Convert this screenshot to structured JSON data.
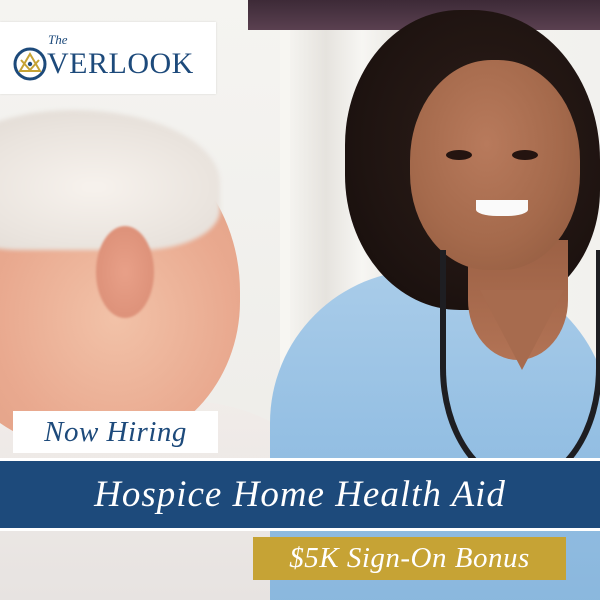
{
  "logo": {
    "the": "The",
    "o_letter": "O",
    "rest": "VERLOOK",
    "color": "#1d4a7b",
    "accent": "#c6a335"
  },
  "banner": {
    "now_hiring": "Now Hiring",
    "position_title": "Hospice Home Health Aid",
    "bonus": "$5K Sign-On Bonus"
  },
  "colors": {
    "navy": "#1d4a7b",
    "gold": "#c6a335",
    "white": "#ffffff"
  }
}
